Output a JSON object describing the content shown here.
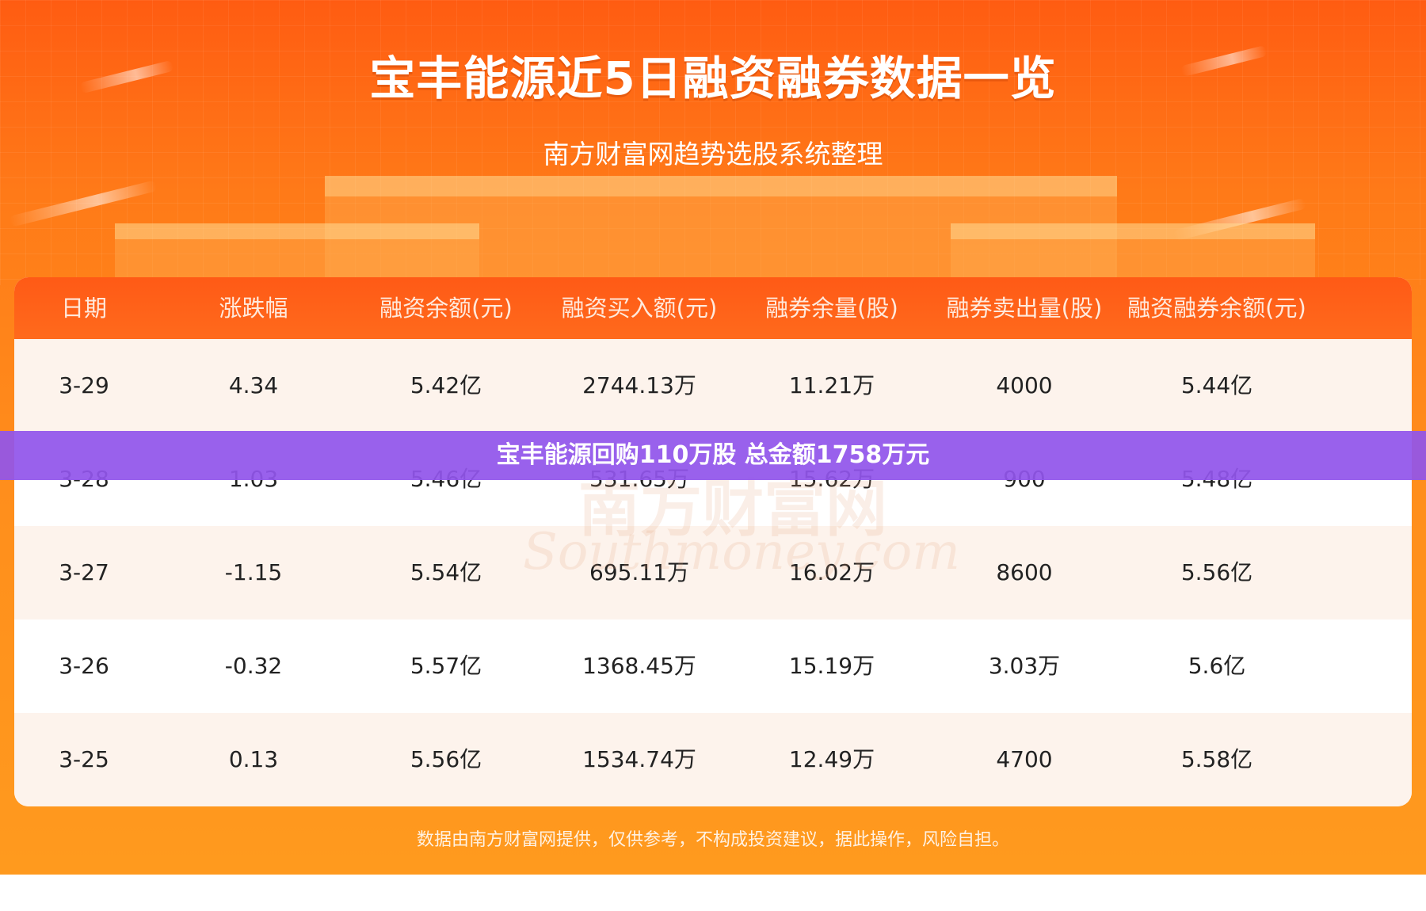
{
  "header": {
    "title": "宝丰能源近5日融资融券数据一览",
    "subtitle": "南方财富网趋势选股系统整理"
  },
  "table": {
    "columns": [
      "日期",
      "涨跌幅",
      "融资余额(元)",
      "融资买入额(元)",
      "融券余量(股)",
      "融券卖出量(股)",
      "融资融券余额(元)"
    ],
    "rows": [
      [
        "3-29",
        "4.34",
        "5.42亿",
        "2744.13万",
        "11.21万",
        "4000",
        "5.44亿"
      ],
      [
        "3-28",
        "1.03",
        "5.46亿",
        "531.65万",
        "15.62万",
        "900",
        "5.48亿"
      ],
      [
        "3-27",
        "-1.15",
        "5.54亿",
        "695.11万",
        "16.02万",
        "8600",
        "5.56亿"
      ],
      [
        "3-26",
        "-0.32",
        "5.57亿",
        "1368.45万",
        "15.19万",
        "3.03万",
        "5.6亿"
      ],
      [
        "3-25",
        "0.13",
        "5.56亿",
        "1534.74万",
        "12.49万",
        "4700",
        "5.58亿"
      ]
    ]
  },
  "watermark": {
    "cn": "南方财富网",
    "en": "Southmoney.com"
  },
  "banner": {
    "text": "宝丰能源回购110万股 总金额1758万元"
  },
  "footer": {
    "disclaimer": "数据由南方财富网提供，仅供参考，不构成投资建议，据此操作，风险自担。"
  },
  "colors": {
    "header_orange": "#ff5a16",
    "background_orange": "#ff8e1c",
    "banner_purple": "#9155eb"
  }
}
